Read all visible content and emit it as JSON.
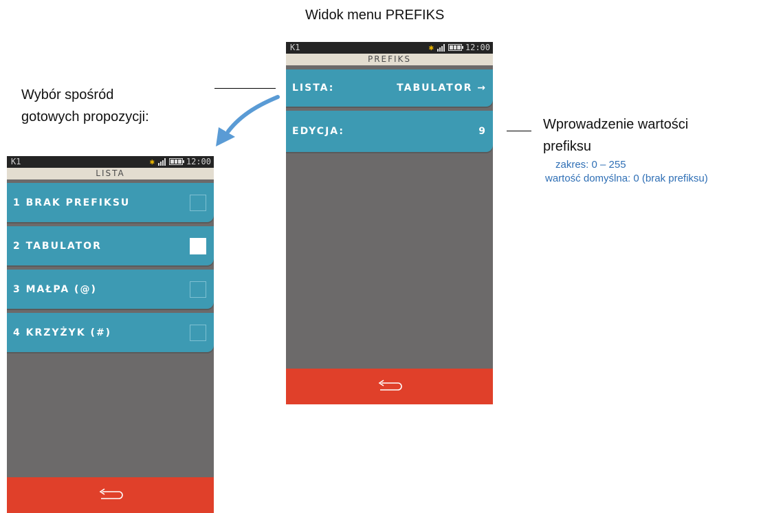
{
  "annotations": {
    "top_caption": "Widok menu PREFIKS",
    "left_caption_line1": "Wybór spośród",
    "left_caption_line2": "gotowych propozycji:",
    "right_caption_line1": "Wprowadzenie wartości",
    "right_caption_line2": "prefiksu",
    "right_note1": "zakres: 0 – 255",
    "right_note2": "wartość domyślna: 0 (brak prefiksu)"
  },
  "prefiks_screen": {
    "status": {
      "carrier": "K1",
      "time": "12:00"
    },
    "title": "PREFIKS",
    "items": [
      {
        "label": "LISTA:",
        "value": "TABULATOR →"
      },
      {
        "label": "EDYCJA:",
        "value": "9"
      }
    ],
    "back_icon": "return-arrow-icon"
  },
  "lista_screen": {
    "status": {
      "carrier": "K1",
      "time": "12:00"
    },
    "title": "LISTA",
    "items": [
      {
        "label": "1 BRAK PREFIKSU",
        "checked": false
      },
      {
        "label": "2 TABULATOR",
        "checked": true
      },
      {
        "label": "3 MAŁPA (@)",
        "checked": false
      },
      {
        "label": "4 KRZYŻYK (#)",
        "checked": false
      }
    ],
    "back_icon": "return-arrow-icon"
  },
  "colors": {
    "item_bg": "#3d9ab3",
    "screen_bg": "#6c6a6a",
    "titlebar_bg": "#e3ddd0",
    "back_bar": "#e0402a",
    "bluetooth": "#e8b400",
    "arrow": "#5a9bd5",
    "note_text": "#2f6fb5"
  }
}
